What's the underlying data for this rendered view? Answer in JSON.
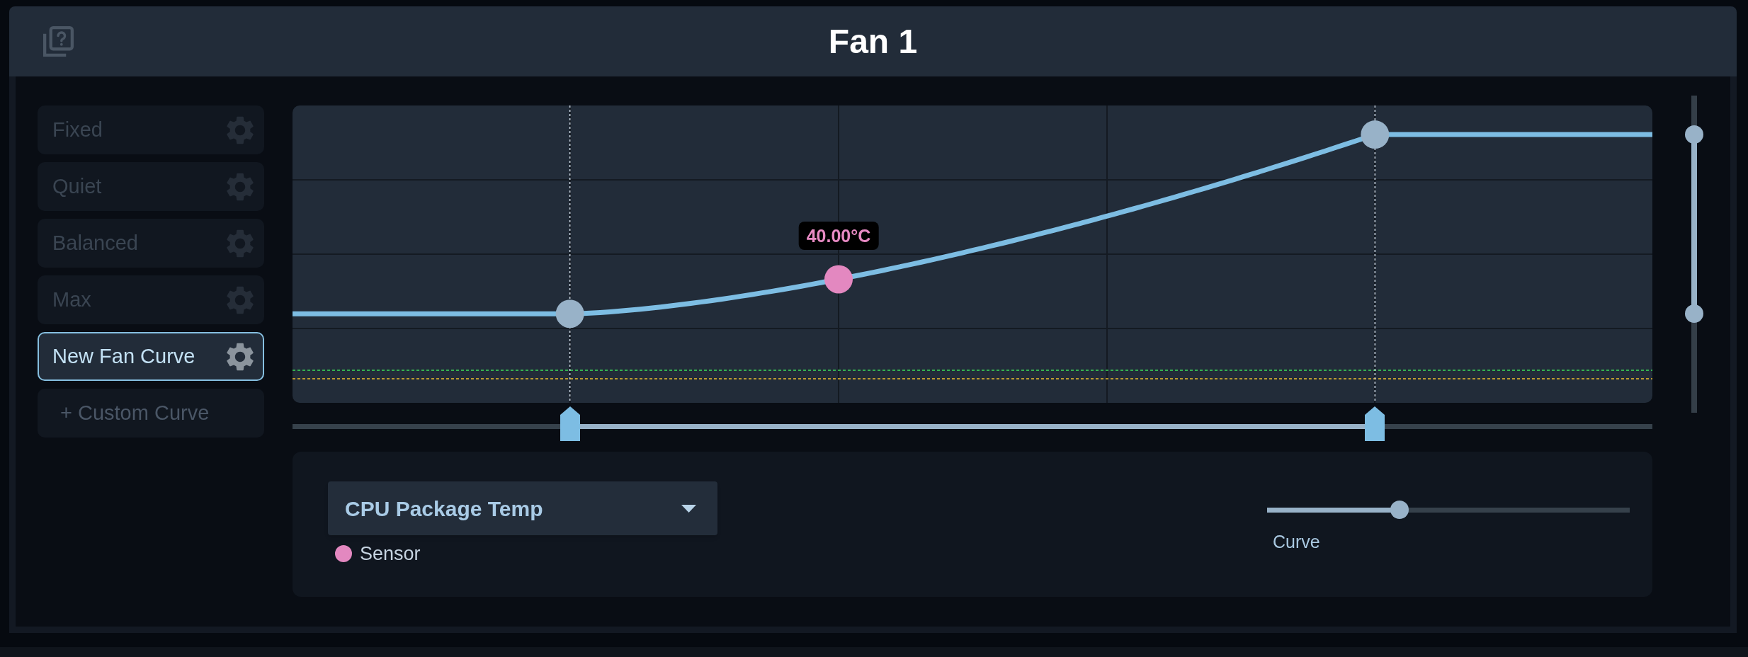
{
  "header": {
    "title": "Fan 1"
  },
  "sidebar": {
    "items": [
      {
        "label": "Fixed",
        "kind": "preset",
        "selected": false
      },
      {
        "label": "Quiet",
        "kind": "preset",
        "selected": false
      },
      {
        "label": "Balanced",
        "kind": "preset",
        "selected": false
      },
      {
        "label": "Max",
        "kind": "preset",
        "selected": false
      },
      {
        "label": "New Fan Curve",
        "kind": "preset",
        "selected": true
      },
      {
        "label": "+ Custom Curve",
        "kind": "add",
        "selected": false
      }
    ]
  },
  "graph": {
    "tooltip": "40.00°C"
  },
  "range_slider": {
    "handles": [
      {
        "level": 0.204
      },
      {
        "level": 0.796
      }
    ]
  },
  "vertical_slider": {
    "handles": [
      {
        "level": 0.877
      },
      {
        "level": 0.312
      }
    ]
  },
  "sensor_panel": {
    "dropdown": {
      "value": "CPU Package Temp"
    },
    "legend": {
      "label": "Sensor"
    },
    "curve_slider": {
      "label": "Curve",
      "level": 0.365
    }
  }
}
